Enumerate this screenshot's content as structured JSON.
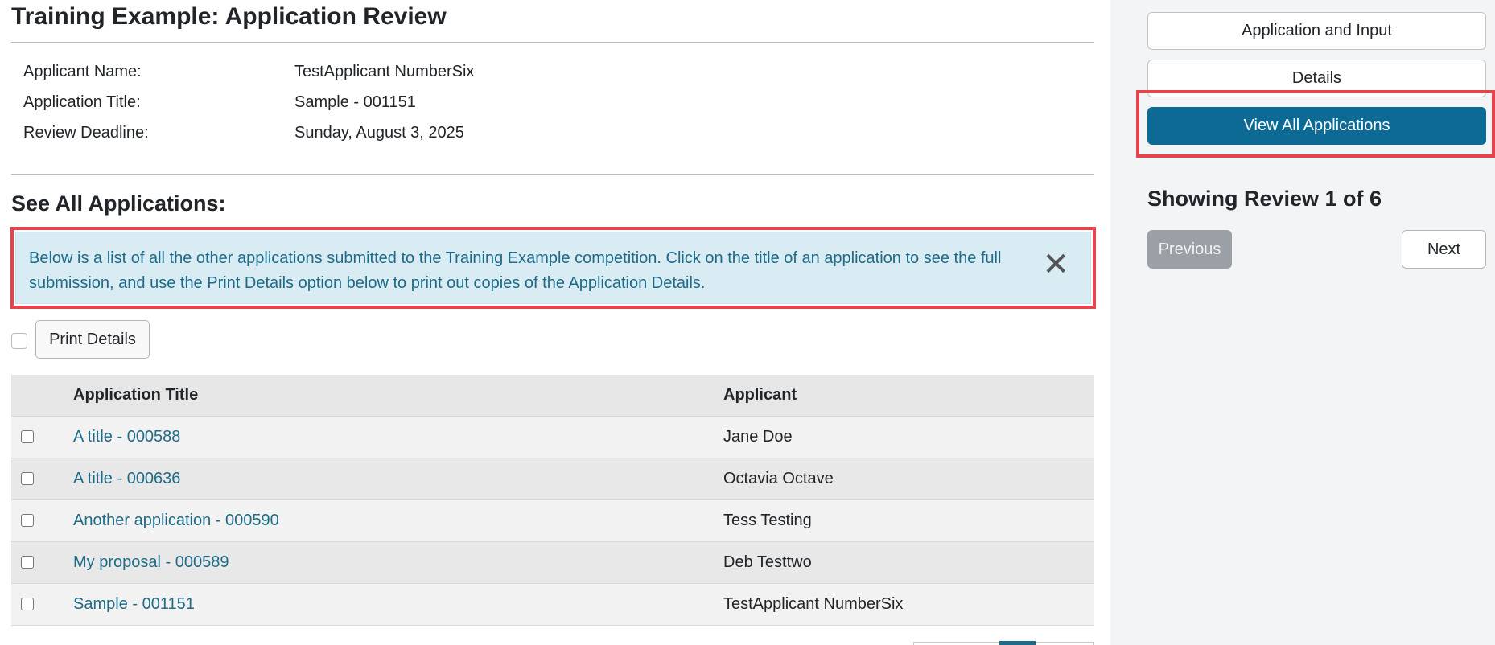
{
  "page": {
    "title": "Training Example: Application Review"
  },
  "details": [
    {
      "label": "Applicant Name:",
      "value": "TestApplicant NumberSix"
    },
    {
      "label": "Application Title:",
      "value": "Sample - 001151"
    },
    {
      "label": "Review Deadline:",
      "value": "Sunday, August 3, 2025"
    }
  ],
  "section": {
    "title": "See All Applications:"
  },
  "alert": {
    "text": "Below is a list of all the other applications submitted to the Training Example competition. Click on the title of an application to see the full submission, and use the Print Details option below to print out copies of the Application Details.",
    "close_glyph": "✕"
  },
  "toolbar": {
    "print_label": "Print Details"
  },
  "table": {
    "headers": {
      "title": "Application Title",
      "applicant": "Applicant"
    },
    "rows": [
      {
        "title": "A title - 000588",
        "applicant": "Jane Doe"
      },
      {
        "title": "A title - 000636",
        "applicant": "Octavia Octave"
      },
      {
        "title": "Another application - 000590",
        "applicant": "Tess Testing"
      },
      {
        "title": "My proposal - 000589",
        "applicant": "Deb Testtwo"
      },
      {
        "title": "Sample - 001151",
        "applicant": "TestApplicant NumberSix"
      }
    ]
  },
  "sidebar": {
    "buttons": {
      "application_and_input": "Application and Input",
      "details": "Details",
      "view_all": "View All Applications"
    },
    "showing": "Showing Review 1 of 6",
    "previous": "Previous",
    "next": "Next"
  },
  "colors": {
    "primary": "#0c6a94",
    "link": "#1d6b88",
    "alert_bg": "#d9ecf3",
    "highlight": "#e5444c",
    "disabled": "#9aa0a5"
  }
}
